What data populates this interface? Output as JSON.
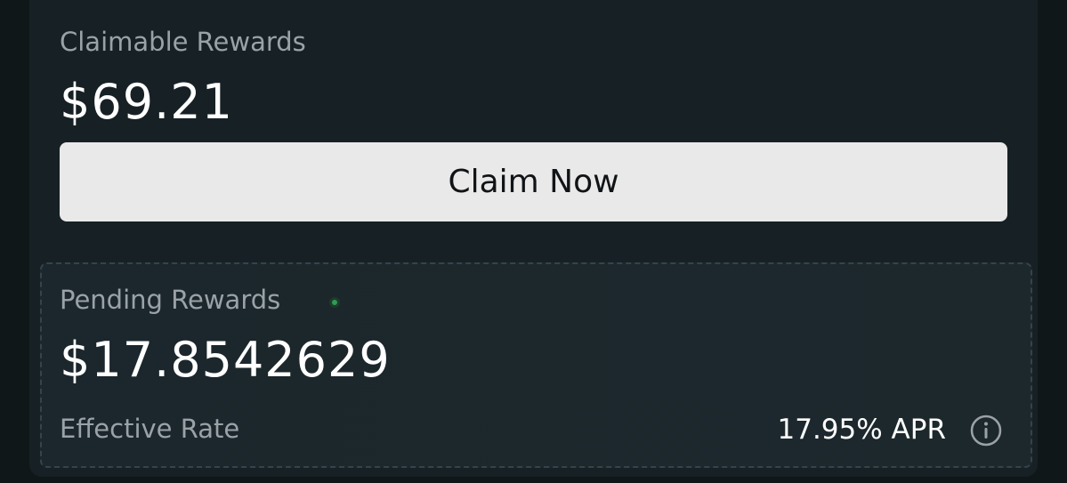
{
  "claimable": {
    "label": "Claimable Rewards",
    "value": "$69.21",
    "button_label": "Claim Now"
  },
  "pending": {
    "label": "Pending Rewards",
    "value": "$17.8542629",
    "live_indicator_color": "#2e9c55"
  },
  "rate": {
    "label": "Effective Rate",
    "value": "17.95% APR",
    "info_icon": "info-icon"
  },
  "colors": {
    "background": "#0f1719",
    "card": "#172125",
    "button": "#e9e9e9",
    "text_primary": "#ffffff",
    "text_secondary": "#9aa2a8"
  }
}
